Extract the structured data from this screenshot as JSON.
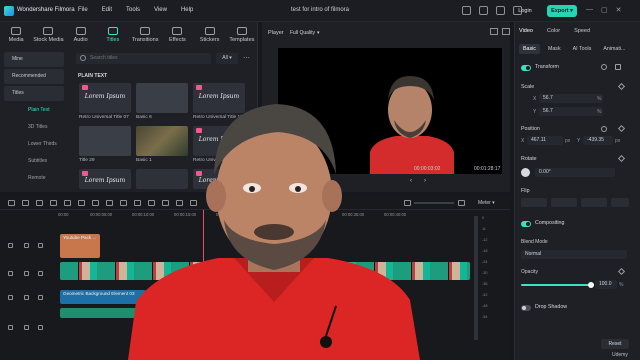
{
  "app": {
    "name": "Wondershare Filmora",
    "menu": [
      "File",
      "Edit",
      "Tools",
      "View",
      "Help"
    ],
    "project_title": "test for intro of filmora",
    "login_label": "Login",
    "export_label": "Export ▾"
  },
  "media": {
    "tabs": [
      "Media",
      "Stock Media",
      "Audio",
      "Titles",
      "Transitions",
      "Effects",
      "Stickers",
      "Templates"
    ],
    "active_tab": "Titles",
    "categories": [
      "Mine",
      "Recommended",
      "Titles",
      "Plain Text",
      "3D Titles",
      "Lower Thirds",
      "Subtitles",
      "Remote"
    ],
    "search_placeholder": "Search titles",
    "filter_value": "All ▾",
    "section_label": "PLAIN TEXT",
    "thumbnails": [
      {
        "text": "Lorem Ipsum",
        "label": "Retro Universal Title 07"
      },
      {
        "text": "",
        "label": "Basic 6"
      },
      {
        "text": "Lorem Ipsum",
        "label": "Retro Universal Title 11"
      },
      {
        "text": "",
        "label": "Title 29"
      },
      {
        "text": "",
        "label": "Basic 1"
      },
      {
        "text": "Lorem Ipsum",
        "label": "Retro Universal Title 15"
      },
      {
        "text": "Lorem Ipsum",
        "label": ""
      },
      {
        "text": "",
        "label": ""
      },
      {
        "text": "Lorem Ipsum",
        "label": ""
      }
    ]
  },
  "preview": {
    "player_label": "Player",
    "quality": "Full Quality",
    "time_current": "00:00:03:02",
    "time_total": "00:01:28:17"
  },
  "properties": {
    "tabs": [
      "Video",
      "Color",
      "Speed"
    ],
    "subtabs": [
      "Basic",
      "Mask",
      "AI Tools",
      "Animati..."
    ],
    "transform": "Transform",
    "scale": "Scale",
    "scale_x": "56.7",
    "scale_y": "56.7",
    "scale_unit": "%",
    "position": "Position",
    "pos_x": "467.11",
    "pos_y": "-439.35",
    "pos_unit": "px",
    "rotate": "Rotate",
    "rotate_value": "0.00°",
    "flip": "Flip",
    "compositing": "Compositing",
    "blend_mode": "Blend Mode",
    "blend_value": "Normal",
    "opacity": "Opacity",
    "opacity_value": "100.0",
    "opacity_level": 1.0,
    "drop_shadow": "Drop Shadow",
    "reset_label": "Reset"
  },
  "timeline": {
    "meter_label": "Meter ▾",
    "ruler": [
      "00:00",
      "00:00:05:00",
      "00:00:10:00",
      "00:00:15:00",
      "00:00:20:00",
      "00:00:25:00",
      "00:00:30:00",
      "00:00:35:00",
      "00:00:40:00"
    ],
    "meter_scale": [
      "0",
      "-6",
      "-12",
      "-18",
      "-24",
      "-30",
      "-36",
      "-42",
      "-48",
      "-54"
    ],
    "clips": {
      "title_clip": "Youtube Pack ...",
      "bg_clip": "Geometric Background Element 03",
      "bg_clip2": "Geo Backgroun..."
    }
  },
  "watermark": "Udemy",
  "colors": {
    "accent": "#3fe0c2",
    "export": "#26d4b3",
    "playhead": "#e94b6b"
  }
}
